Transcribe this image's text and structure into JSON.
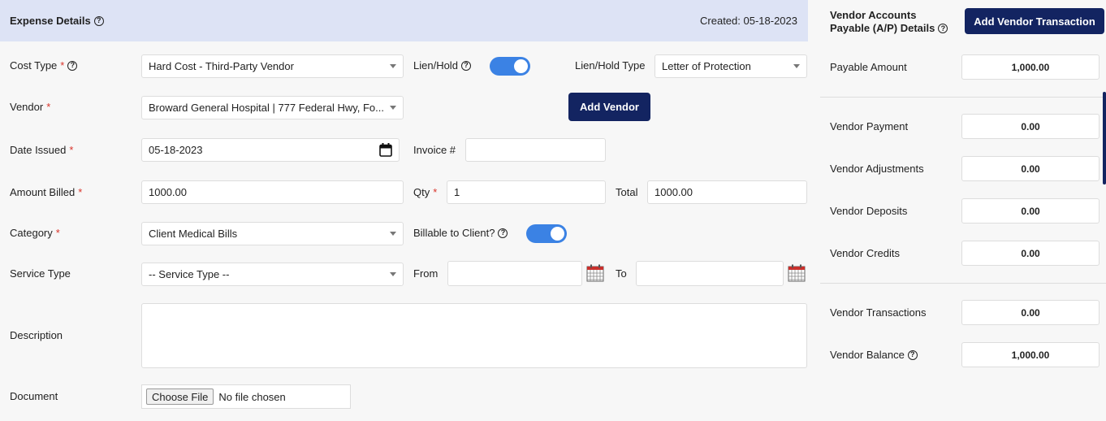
{
  "expense": {
    "title": "Expense Details",
    "created": "Created: 05-18-2023",
    "cost_type": {
      "label": "Cost Type",
      "value": "Hard Cost - Third-Party Vendor"
    },
    "lien_hold": {
      "label": "Lien/Hold",
      "on": true
    },
    "lien_hold_type": {
      "label": "Lien/Hold Type",
      "value": "Letter of Protection"
    },
    "vendor": {
      "label": "Vendor",
      "value": "Broward General Hospital | 777 Federal Hwy, Fo..."
    },
    "add_vendor_label": "Add Vendor",
    "date_issued": {
      "label": "Date Issued",
      "value": "05-18-2023"
    },
    "invoice": {
      "label": "Invoice #",
      "value": ""
    },
    "amount_billed": {
      "label": "Amount Billed",
      "value": "1000.00"
    },
    "qty": {
      "label": "Qty",
      "value": "1"
    },
    "total": {
      "label": "Total",
      "value": "1000.00"
    },
    "category": {
      "label": "Category",
      "value": "Client Medical Bills"
    },
    "billable": {
      "label": "Billable to Client?",
      "on": true
    },
    "service_type": {
      "label": "Service Type",
      "value": "-- Service Type --"
    },
    "from": {
      "label": "From",
      "value": ""
    },
    "to": {
      "label": "To",
      "value": ""
    },
    "description": {
      "label": "Description",
      "value": ""
    },
    "document": {
      "label": "Document",
      "button": "Choose File",
      "status": "No file chosen"
    },
    "required_mark": "*"
  },
  "vendor_ap": {
    "title_line1": "Vendor Accounts",
    "title_line2": "Payable (A/P) Details",
    "add_transaction_label": "Add Vendor Transaction",
    "payable_amount": {
      "label": "Payable Amount",
      "value": "1,000.00"
    },
    "vendor_payment": {
      "label": "Vendor Payment",
      "value": "0.00"
    },
    "vendor_adjustments": {
      "label": "Vendor Adjustments",
      "value": "0.00"
    },
    "vendor_deposits": {
      "label": "Vendor Deposits",
      "value": "0.00"
    },
    "vendor_credits": {
      "label": "Vendor Credits",
      "value": "0.00"
    },
    "vendor_transactions": {
      "label": "Vendor Transactions",
      "value": "0.00"
    },
    "vendor_balance": {
      "label": "Vendor Balance",
      "value": "1,000.00"
    }
  },
  "icons": {
    "help": "?"
  },
  "colors": {
    "header_bg": "#dde3f5",
    "button": "#132461",
    "toggle": "#3b82e4",
    "required": "#d9342b"
  }
}
